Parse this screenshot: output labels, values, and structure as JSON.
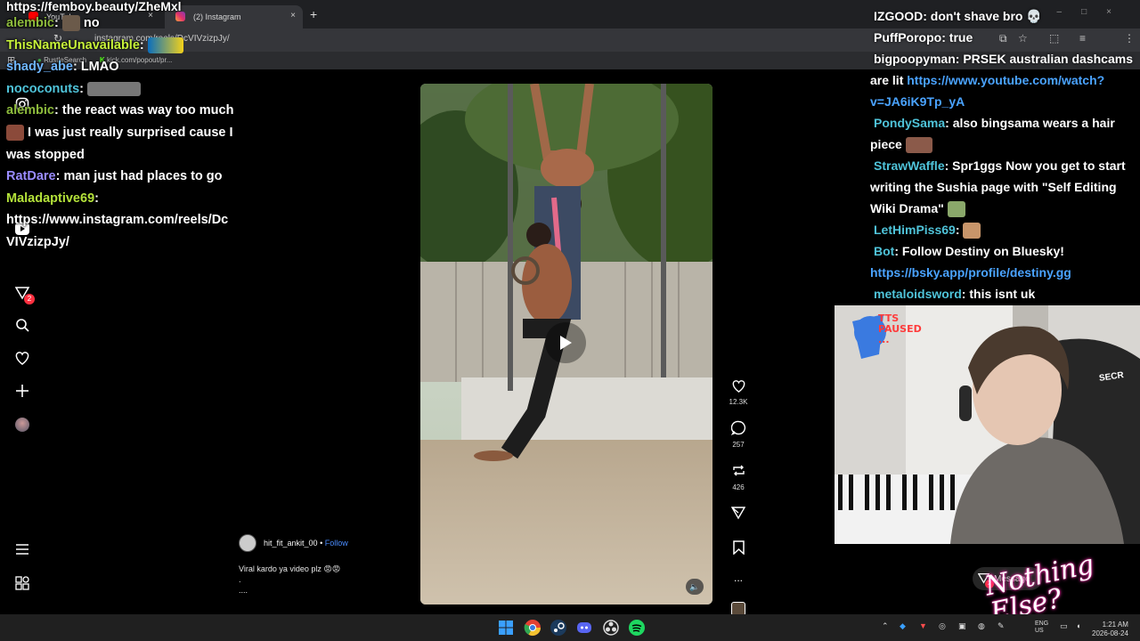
{
  "browser": {
    "tabs": [
      {
        "label": "YouTube",
        "favicon_color": "#ff0000"
      },
      {
        "label": "(2) Instagram",
        "favicon_color": "#e1306c"
      }
    ],
    "new_tab_symbol": "+",
    "close_symbol": "×",
    "address": "instagram.com/reels/DcVIVzizpJy/",
    "bookmarks": [
      "RustleSearch",
      "kick.com/popout/pr..."
    ]
  },
  "overlay_title": "https://femboy.beauty/ZheMxl",
  "chat_left": [
    {
      "user": "alembic",
      "color": "#8dbb3c",
      "text": "no"
    },
    {
      "user": "ThisNameUnavailable",
      "color": "#9acd32",
      "text": ""
    },
    {
      "user": "shady_abe",
      "color": "#6fb6ff",
      "text": "LMAO"
    },
    {
      "user": "nococonuts",
      "color": "#4fc3d9",
      "text": ""
    },
    {
      "user": "alembic",
      "color": "#8dbb3c",
      "text": "the react was way too much"
    },
    {
      "user": "",
      "color": "#ffffff",
      "text": "I was just really surprised cause I"
    },
    {
      "user": "",
      "color": "#ffffff",
      "text": "was stopped"
    },
    {
      "user": "RatDare",
      "color": "#9a8cff",
      "text": "man just had places to go"
    },
    {
      "user": "Maladaptive69",
      "color": "#b4e23a",
      "text": ""
    },
    {
      "user": "",
      "color": "#ffffff",
      "text": "https://www.instagram.com/reels/Dc"
    },
    {
      "user": "",
      "color": "#ffffff",
      "text": "VIVzizpJy/"
    }
  ],
  "chat_right": [
    {
      "user": "IZGOOD",
      "color": "#ffffff",
      "text": "don't shave bro",
      "link": ""
    },
    {
      "user": "PuffPoropo",
      "color": "#ffffff",
      "text": "true",
      "link": ""
    },
    {
      "user": "bigpoopyman",
      "color": "#ffffff",
      "text": "PRSEK australian dashcams",
      "link": ""
    },
    {
      "user": "",
      "color": "#ffffff",
      "text": "are lit",
      "link": "https://www.youtube.com/watch?"
    },
    {
      "user": "",
      "color": "#4aa3ff",
      "text": "",
      "link": "v=JA6iK9Tp_yA"
    },
    {
      "user": "PondySama",
      "color": "#4fc3d9",
      "text": "also bingsama wears a hair",
      "link": ""
    },
    {
      "user": "",
      "color": "#ffffff",
      "text": "piece",
      "link": ""
    },
    {
      "user": "StrawWaffle",
      "color": "#4fc3d9",
      "text": "Spr1ggs Now you get to start",
      "link": ""
    },
    {
      "user": "",
      "color": "#ffffff",
      "text": "writing the Sushia page with \"Self Editing",
      "link": ""
    },
    {
      "user": "",
      "color": "#ffffff",
      "text": "Wiki Drama\"",
      "link": ""
    },
    {
      "user": "LetHimPiss69",
      "color": "#4fc3d9",
      "text": "",
      "link": ""
    },
    {
      "user": "Bot",
      "color": "#4fc3d9",
      "text": "Follow Destiny on Bluesky!",
      "link": ""
    },
    {
      "user": "",
      "color": "#4aa3ff",
      "text": "",
      "link": "https://bsky.app/profile/destiny.gg"
    },
    {
      "user": "metaloidsword",
      "color": "#4fc3d9",
      "text": "this isnt uk",
      "link": ""
    }
  ],
  "reel": {
    "username": "hit_fit_ankit_00",
    "separator": "•",
    "follow_label": "Follow",
    "caption_lines": [
      "Viral kardo ya video plz 😡😡",
      ".",
      "...."
    ],
    "likes": "12.3K",
    "comments": "257",
    "reposts": "426",
    "more": "..."
  },
  "webcam": {
    "tts_label": "TTS PAUSED",
    "tts_dots": "...",
    "brand_text": "SECR"
  },
  "nothing_else": "Nothing Else?",
  "message_label": "Message",
  "message_badge": "2",
  "sidebar_badge": "2",
  "clock": {
    "time": "1:21 AM",
    "date": "2026-08-24"
  },
  "tray": {
    "lang": "ENG",
    "region": "US"
  },
  "colors": {
    "instagram_blue": "#4a8cff",
    "tts_red": "#ff3b3b",
    "badge_red": "#ff3040",
    "link_blue": "#4aa3ff"
  }
}
